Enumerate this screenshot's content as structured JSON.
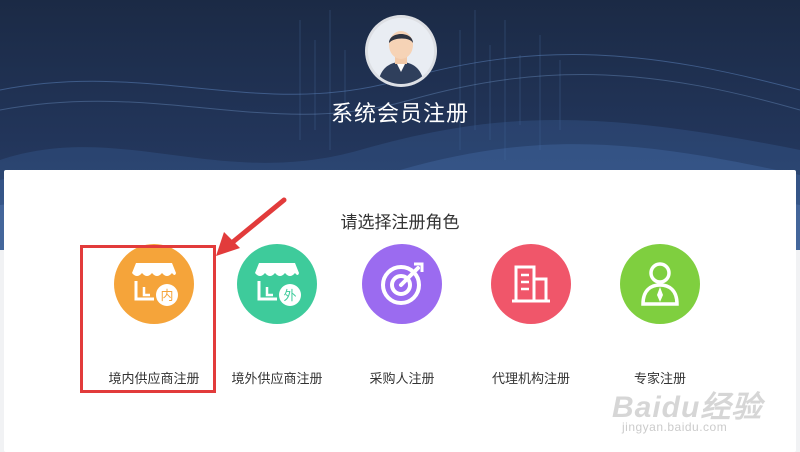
{
  "header": {
    "title": "系统会员注册"
  },
  "main": {
    "prompt": "请选择注册角色",
    "roles": [
      {
        "label": "境内供应商注册",
        "icon": "storefront-domestic-icon",
        "badge": "内",
        "color": "#f5a43a"
      },
      {
        "label": "境外供应商注册",
        "icon": "storefront-overseas-icon",
        "badge": "外",
        "color": "#3ecb9b"
      },
      {
        "label": "采购人注册",
        "icon": "target-icon",
        "color": "#9b6bf0"
      },
      {
        "label": "代理机构注册",
        "icon": "building-icon",
        "color": "#f0566a"
      },
      {
        "label": "专家注册",
        "icon": "expert-person-icon",
        "color": "#7fcf3f"
      }
    ]
  },
  "annotation": {
    "highlight_color": "#e23b3b"
  },
  "watermark": {
    "brand": "Baidu经验",
    "url": "jingyan.baidu.com"
  }
}
